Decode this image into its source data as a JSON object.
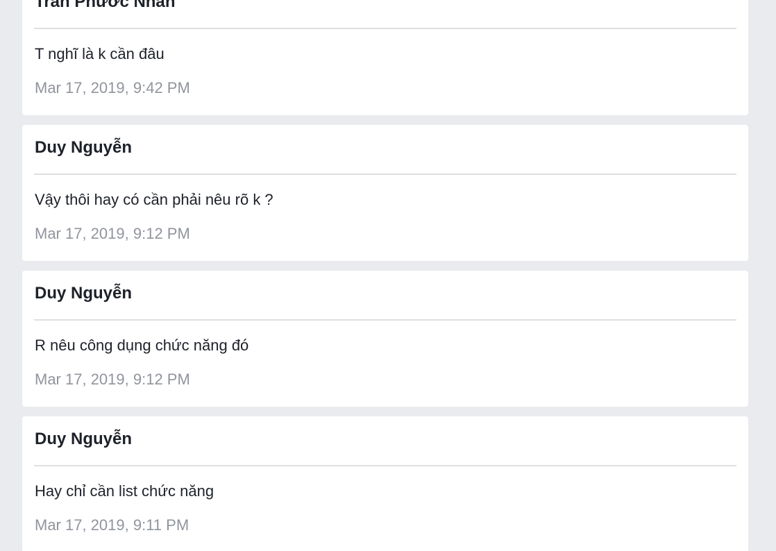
{
  "comments": [
    {
      "author": "Trần Phước Nhân",
      "message": "T nghĩ là k cần đâu",
      "timestamp": "Mar 17, 2019, 9:42 PM"
    },
    {
      "author": "Duy Nguyễn",
      "message": "Vậy thôi hay có cần phải nêu rõ k ?",
      "timestamp": "Mar 17, 2019, 9:12 PM"
    },
    {
      "author": "Duy Nguyễn",
      "message": "R nêu công dụng chức năng đó",
      "timestamp": "Mar 17, 2019, 9:12 PM"
    },
    {
      "author": "Duy Nguyễn",
      "message": "Hay chỉ cần list chức năng",
      "timestamp": "Mar 17, 2019, 9:11 PM"
    }
  ]
}
